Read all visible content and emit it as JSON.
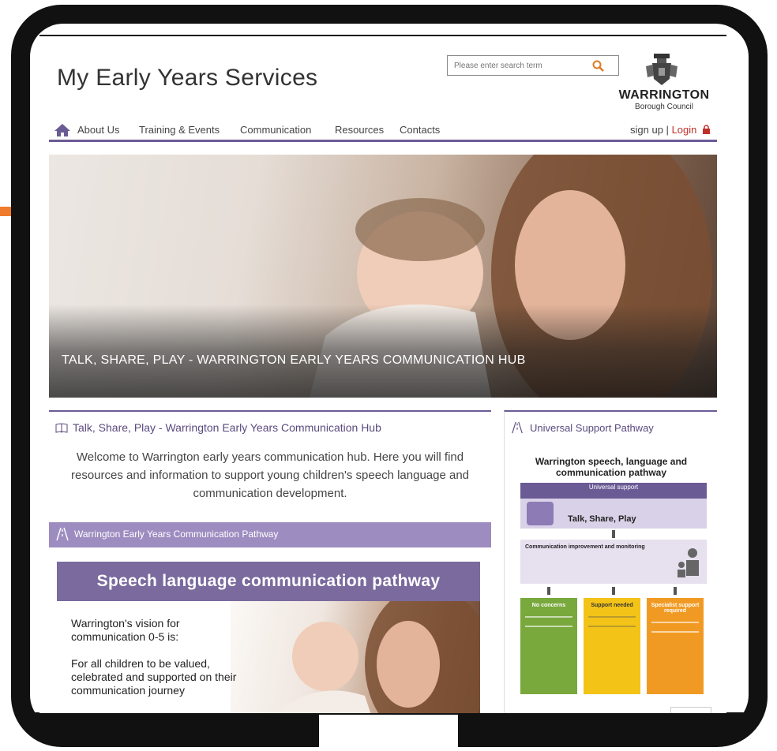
{
  "site": {
    "title": "My Early Years Services",
    "search_placeholder": "Please enter search term",
    "council_name": "WARRINGTON",
    "council_sub": "Borough Council"
  },
  "nav": {
    "items": [
      "About Us",
      "Training & Events",
      "Communication",
      "Resources",
      "Contacts"
    ],
    "sign_up": "sign up",
    "separator": "|",
    "login": "Login"
  },
  "hero": {
    "caption": "TALK, SHARE, PLAY - WARRINGTON EARLY YEARS COMMUNICATION HUB"
  },
  "main": {
    "heading": "Talk, Share, Play - Warrington Early Years Communication Hub",
    "welcome": "Welcome to Warrington early years communication hub.  Here you will find resources and information to support young children's speech language and communication development.",
    "pathway_heading": "Warrington Early Years Communication Pathway",
    "banner": "Speech language communication pathway",
    "vision_1": "Warrington's vision for communication 0-5 is:",
    "vision_2": "For all children to be valued, celebrated and supported on their communication journey"
  },
  "side": {
    "heading": "Universal Support Pathway",
    "infographic_title": "Warrington speech, language and communication pathway",
    "universal": "Universal support",
    "talk": "Talk, Share, Play",
    "monitoring": "Communication improvement and monitoring",
    "col_1": "No concerns",
    "col_2": "Support needed",
    "col_3": "Specialist support required"
  },
  "colors": {
    "brand_purple": "#6b5b95",
    "pathway_bar": "#9d8cc0",
    "login_red": "#c0302a",
    "frame": "#111111",
    "accent_orange": "#f07b2c"
  }
}
